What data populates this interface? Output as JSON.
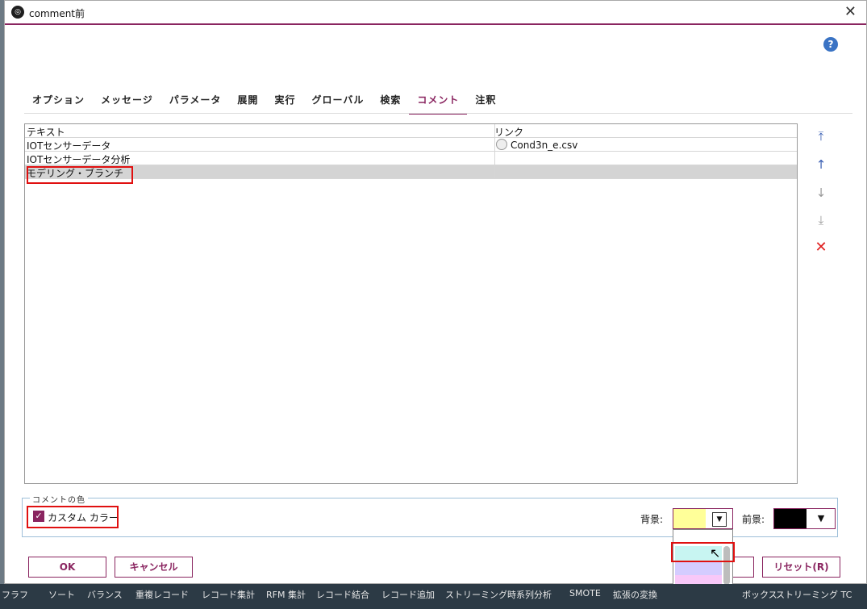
{
  "window": {
    "title": "comment前",
    "close_glyph": "✕",
    "help_glyph": "?"
  },
  "tabs": [
    {
      "label": "オプション"
    },
    {
      "label": "メッセージ"
    },
    {
      "label": "パラメータ"
    },
    {
      "label": "展開"
    },
    {
      "label": "実行"
    },
    {
      "label": "グローバル"
    },
    {
      "label": "検索"
    },
    {
      "label": "コメント",
      "active": true
    },
    {
      "label": "注釈"
    }
  ],
  "table": {
    "headers": [
      "テキスト",
      "リンク"
    ],
    "rows": [
      {
        "text": "IOTセンサーデータ",
        "link": "Cond3n_e.csv"
      },
      {
        "text": "IOTセンサーデータ分析",
        "link": ""
      },
      {
        "text": "モデリング・ブランチ",
        "link": ""
      }
    ],
    "selected_row": 2
  },
  "side_buttons": [
    {
      "name": "move-top-icon",
      "glyph": "⤒"
    },
    {
      "name": "move-up-icon",
      "glyph": "↑"
    },
    {
      "name": "move-down-icon",
      "glyph": "↓"
    },
    {
      "name": "move-bottom-icon",
      "glyph": "⤓"
    },
    {
      "name": "delete-icon",
      "glyph": "✕"
    }
  ],
  "color_group": {
    "label": "コメントの色",
    "custom_color_label": "カスタム カラー",
    "custom_color_checked": true,
    "background_label": "背景:",
    "foreground_label": "前景:",
    "background_color": "#ffff99",
    "foreground_color": "#000000"
  },
  "dropdown_colors": [
    "#ffffff",
    "#c8f5f2",
    "#d4ccff",
    "#f8c8f8",
    "#ffc8c8",
    "#ffecc8"
  ],
  "buttons": {
    "ok": "OK",
    "cancel": "キャンセル",
    "reset": "リセット(R)"
  },
  "taskbar": [
    "フラフ",
    "ソート",
    "バランス",
    "重複レコード",
    "レコード集計",
    "RFM 集計",
    "レコード結合",
    "レコード追加",
    "ストリーミング時系列分析",
    "SMOTE",
    "拡張の変換",
    "ボックス",
    "ストリーミング TC"
  ],
  "accent": "#8a2560"
}
